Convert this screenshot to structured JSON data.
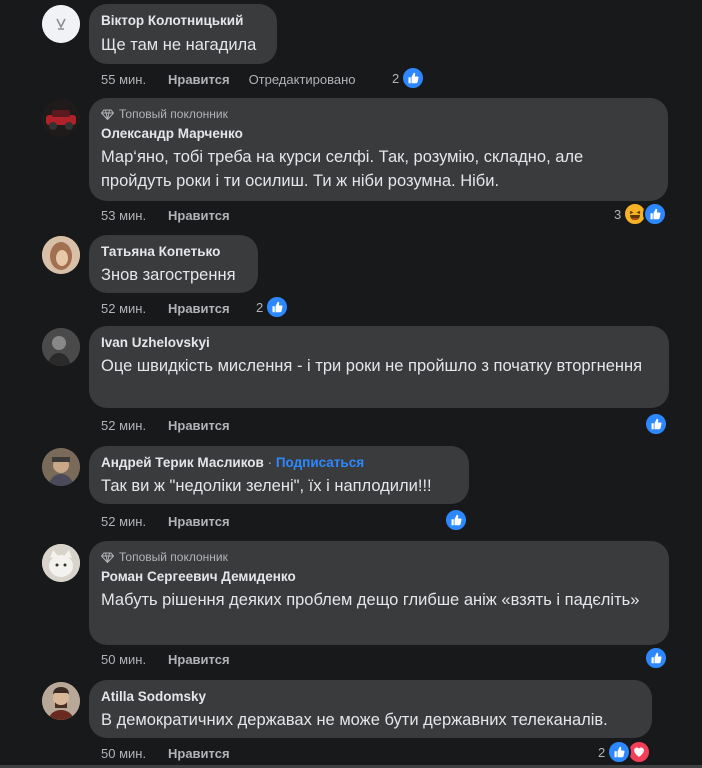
{
  "comments": [
    {
      "author": "Віктор Колотницький",
      "text": "Ще там не нагадила",
      "time": "55 мин.",
      "like_label": "Нравится",
      "edited_label": "Отредактировано",
      "reaction_count": "2",
      "reactions": [
        "like"
      ]
    },
    {
      "badge": "Топовый поклонник",
      "author": "Олександр Марченко",
      "text": "Мар‘яно, тобі треба на курси селфі. Так, розумію, складно, але пройдуть роки і ти осилиш. Ти ж ніби розумна. Ніби.",
      "time": "53 мин.",
      "like_label": "Нравится",
      "reaction_count": "3",
      "reactions": [
        "haha",
        "like"
      ]
    },
    {
      "author": "Татьяна Копетько",
      "text": "Знов загострення",
      "time": "52 мин.",
      "like_label": "Нравится",
      "reaction_count": "2",
      "reactions": [
        "like"
      ]
    },
    {
      "author": "Ivan Uzhelovskyi",
      "text": "Оце швидкість мислення - і три роки не пройшло з початку вторгнення",
      "time": "52 мин.",
      "like_label": "Нравится",
      "reactions": [
        "like"
      ]
    },
    {
      "author": "Андрей Терик Масликов",
      "separator": " · ",
      "follow_label": "Подписаться",
      "text": "Так ви ж \"недоліки зелені\", їх і наплодили!!!",
      "time": "52 мин.",
      "like_label": "Нравится",
      "reactions": [
        "like"
      ]
    },
    {
      "badge": "Топовый поклонник",
      "author": "Роман Сергеевич Демиденко",
      "text": "Мабуть рішення деяких проблем дещо глибше аніж «взять і падєліть»",
      "time": "50 мин.",
      "like_label": "Нравится",
      "reactions": [
        "like"
      ]
    },
    {
      "author": "Atilla Sodomsky",
      "text": "В демократичних державах не може бути державних телеканалів.",
      "time": "50 мин.",
      "like_label": "Нравится",
      "reaction_count": "2",
      "reactions": [
        "like",
        "love"
      ]
    }
  ],
  "icons": {
    "like": "thumbs-up-icon",
    "haha": "laughing-face-icon",
    "love": "heart-icon",
    "badge": "diamond-icon"
  },
  "colors": {
    "background": "#18191a",
    "bubble": "#3a3b3c",
    "like_blue": "#2d88ff",
    "haha_yellow": "#f7b125",
    "love_red": "#f33e58",
    "secondary_text": "#b0b3b8"
  }
}
